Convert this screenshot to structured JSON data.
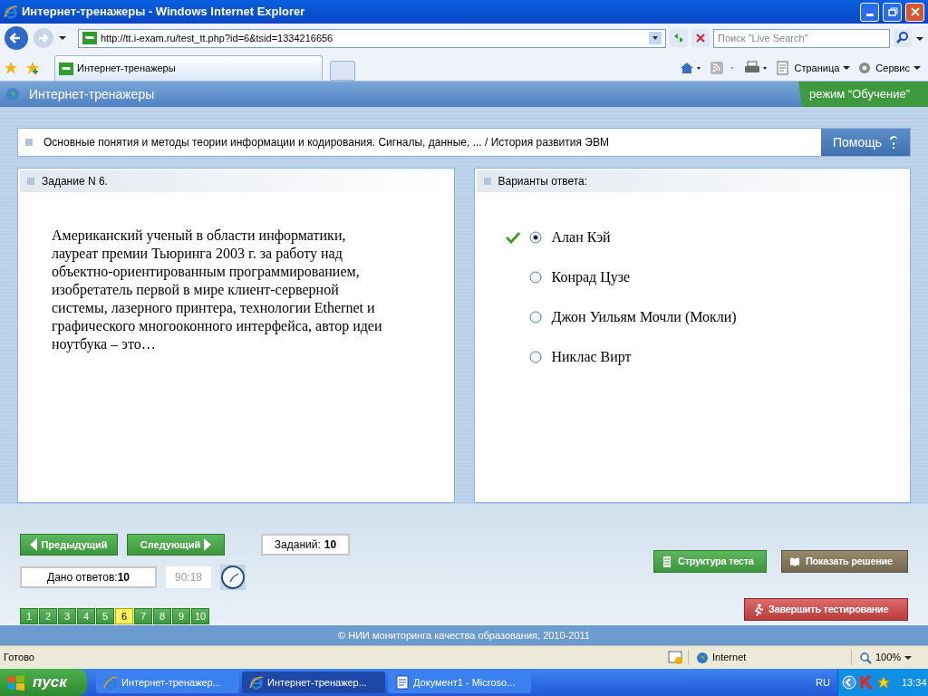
{
  "window": {
    "title": "Интернет-тренажеры - Windows Internet Explorer"
  },
  "browser": {
    "address": "http://tt.i-exam.ru/test_tt.php?id=6&tsid=1334216656",
    "search_placeholder": "Поиск \"Live Search\"",
    "tab": "Интернет-тренажеры",
    "toolbar": [
      "Страница",
      "Сервис"
    ]
  },
  "header": {
    "title": "Интернет-тренажеры",
    "mode": "режим “Обучение”"
  },
  "breadcrumb": "Основные понятия и методы теории информации и кодирования. Сигналы, данные, ... / История развития ЭВМ",
  "help": "Помощь",
  "task": {
    "heading": "Задание N 6.",
    "text": "Американский ученый в области информатики, лауреат премии Тьюринга 2003 г. за работу над объектно-ориентированным программированием, изобретатель первой в мире клиент-серверной системы, лазерного принтера, технологии Ethernet и графического многооконного интерфейса, автор идеи ноутбука – это…"
  },
  "answers": {
    "heading": "Варианты ответа:",
    "options": [
      {
        "label": "Алан Кэй",
        "selected": true,
        "checkmark": true
      },
      {
        "label": "Конрад Цузе",
        "selected": false,
        "checkmark": false
      },
      {
        "label": "Джон Уильям Мочли (Мокли)",
        "selected": false,
        "checkmark": false
      },
      {
        "label": "Никлас Вирт",
        "selected": false,
        "checkmark": false
      }
    ]
  },
  "nav": {
    "prev": "Предыдущий",
    "next": "Следующий",
    "tasks_label": "Заданий:",
    "tasks_count": "10",
    "answered_label": "Дано ответов:",
    "answered_count": "10",
    "timer": "90:18",
    "pages": [
      {
        "label": "1",
        "selected": false
      },
      {
        "label": "2",
        "selected": false
      },
      {
        "label": "3",
        "selected": false
      },
      {
        "label": "4",
        "selected": false
      },
      {
        "label": "5",
        "selected": false
      },
      {
        "label": "6",
        "selected": true
      },
      {
        "label": "7",
        "selected": false
      },
      {
        "label": "8",
        "selected": false
      },
      {
        "label": "9",
        "selected": false
      },
      {
        "label": "10",
        "selected": false
      }
    ],
    "structure": "Структура теста",
    "solution": "Показать решение",
    "finish": "Завершить тестирование"
  },
  "footer": "© НИИ мониторинга качества образования, 2010-2011",
  "status": {
    "text": "Готово",
    "zone": "Internet",
    "zoom": "100%"
  },
  "taskbar": {
    "start": "пуск",
    "items": [
      {
        "label": "Интернет-тренажер...",
        "selected": false,
        "kind": "browser"
      },
      {
        "label": "Интернет-тренажер...",
        "selected": true,
        "kind": "browser"
      },
      {
        "label": "Документ1 - Microso...",
        "selected": false,
        "kind": "document"
      }
    ],
    "lang": "RU",
    "clock": "13:34"
  }
}
